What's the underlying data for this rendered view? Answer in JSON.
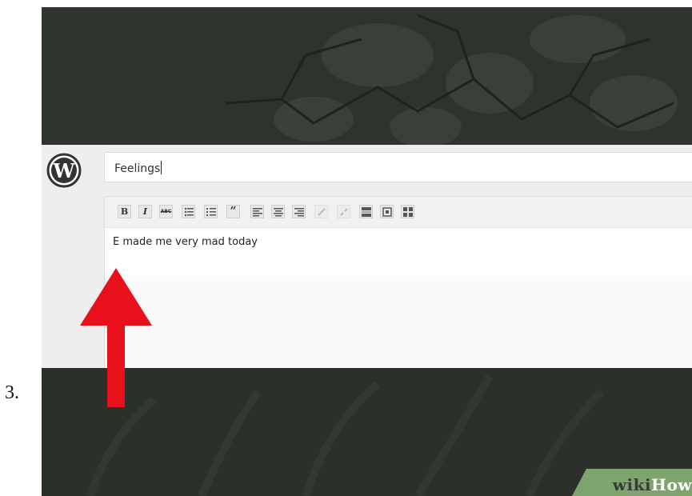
{
  "step": {
    "number": "3."
  },
  "post": {
    "title": "Feelings",
    "body": "E made me very mad today"
  },
  "toolbar": {
    "items": [
      {
        "name": "bold-button",
        "label": "B"
      },
      {
        "name": "italic-button",
        "label": "I"
      },
      {
        "name": "strikethrough-button",
        "label": "ABC"
      },
      {
        "name": "bullet-list-button",
        "label": ""
      },
      {
        "name": "numbered-list-button",
        "label": ""
      },
      {
        "name": "blockquote-button",
        "label": "“"
      },
      {
        "name": "align-left-button",
        "label": ""
      },
      {
        "name": "align-center-button",
        "label": ""
      },
      {
        "name": "align-right-button",
        "label": ""
      },
      {
        "name": "insert-link-button",
        "label": ""
      },
      {
        "name": "remove-link-button",
        "label": ""
      },
      {
        "name": "insert-more-button",
        "label": ""
      },
      {
        "name": "fullscreen-button",
        "label": ""
      },
      {
        "name": "kitchen-sink-button",
        "label": ""
      }
    ]
  },
  "watermark": {
    "part1": "wiki",
    "part2": "How"
  },
  "colors": {
    "arrow": "#e8101a",
    "watermark_bg": "#7fa36c"
  }
}
